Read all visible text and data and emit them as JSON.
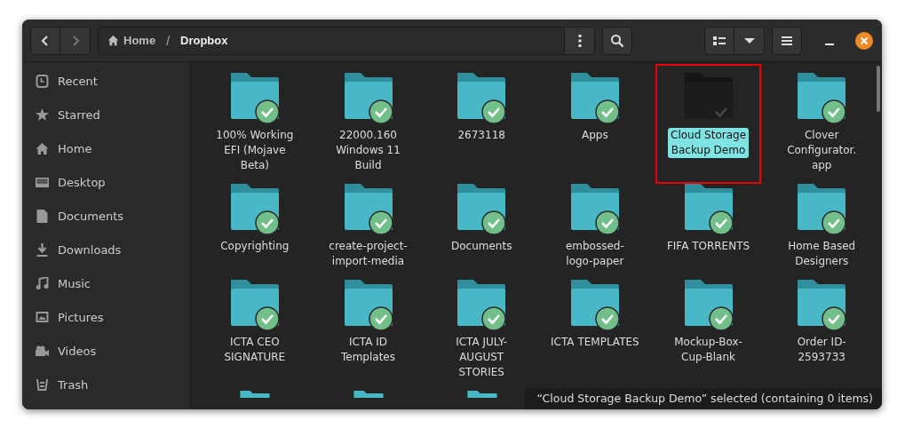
{
  "toolbar": {
    "back": {
      "disabled": false
    },
    "forward": {
      "disabled": true
    },
    "separator": "/",
    "path": [
      {
        "label": "Home",
        "kind": "home"
      },
      {
        "label": "Dropbox",
        "kind": "folder"
      }
    ]
  },
  "sidebar": {
    "items": [
      {
        "label": "Recent",
        "kind": "recent",
        "selected": false
      },
      {
        "label": "Starred",
        "kind": "starred",
        "selected": false
      },
      {
        "label": "Home",
        "kind": "home",
        "selected": false
      },
      {
        "label": "Desktop",
        "kind": "desktop",
        "selected": false
      },
      {
        "label": "Documents",
        "kind": "documents",
        "selected": false
      },
      {
        "label": "Downloads",
        "kind": "downloads",
        "selected": false
      },
      {
        "label": "Music",
        "kind": "music",
        "selected": false
      },
      {
        "label": "Pictures",
        "kind": "pictures",
        "selected": false
      },
      {
        "label": "Videos",
        "kind": "videos",
        "selected": false
      },
      {
        "label": "Trash",
        "kind": "trash",
        "selected": false
      }
    ]
  },
  "items": [
    {
      "label": "100% Working\nEFI (Mojave\nBeta)",
      "selected": false,
      "synced": true,
      "highlighted": false
    },
    {
      "label": "22000.160\nWindows 11\nBuild",
      "selected": false,
      "synced": true,
      "highlighted": false
    },
    {
      "label": "2673118",
      "selected": false,
      "synced": true,
      "highlighted": false
    },
    {
      "label": "Apps",
      "selected": false,
      "synced": true,
      "highlighted": false
    },
    {
      "label": "Cloud Storage\nBackup Demo",
      "selected": true,
      "synced": true,
      "highlighted": true
    },
    {
      "label": "Clover\nConfigurator.\napp",
      "selected": false,
      "synced": true,
      "highlighted": false
    },
    {
      "label": "Copyrighting",
      "selected": false,
      "synced": true,
      "highlighted": false
    },
    {
      "label": "create-project-\nimport-media",
      "selected": false,
      "synced": true,
      "highlighted": false
    },
    {
      "label": "Documents",
      "selected": false,
      "synced": true,
      "highlighted": false
    },
    {
      "label": "embossed-\nlogo-paper",
      "selected": false,
      "synced": true,
      "highlighted": false
    },
    {
      "label": "FIFA TORRENTS",
      "selected": false,
      "synced": true,
      "highlighted": false
    },
    {
      "label": "Home Based\nDesigners",
      "selected": false,
      "synced": true,
      "highlighted": false
    },
    {
      "label": "ICTA CEO\nSIGNATURE",
      "selected": false,
      "synced": true,
      "highlighted": false
    },
    {
      "label": "ICTA ID\nTemplates",
      "selected": false,
      "synced": true,
      "highlighted": false
    },
    {
      "label": "ICTA JULY-\nAUGUST\nSTORIES",
      "selected": false,
      "synced": true,
      "highlighted": false
    },
    {
      "label": "ICTA TEMPLATES",
      "selected": false,
      "synced": true,
      "highlighted": false
    },
    {
      "label": "Mockup-Box-\nCup-Blank",
      "selected": false,
      "synced": true,
      "highlighted": false
    },
    {
      "label": "Order ID-\n2593733",
      "selected": false,
      "synced": true,
      "highlighted": false
    }
  ],
  "cut_off_items": [
    {
      "kind": "folder"
    },
    {
      "kind": "folder"
    },
    {
      "kind": "folder"
    }
  ],
  "status": "“Cloud Storage Backup Demo” selected  (containing 0 items)"
}
